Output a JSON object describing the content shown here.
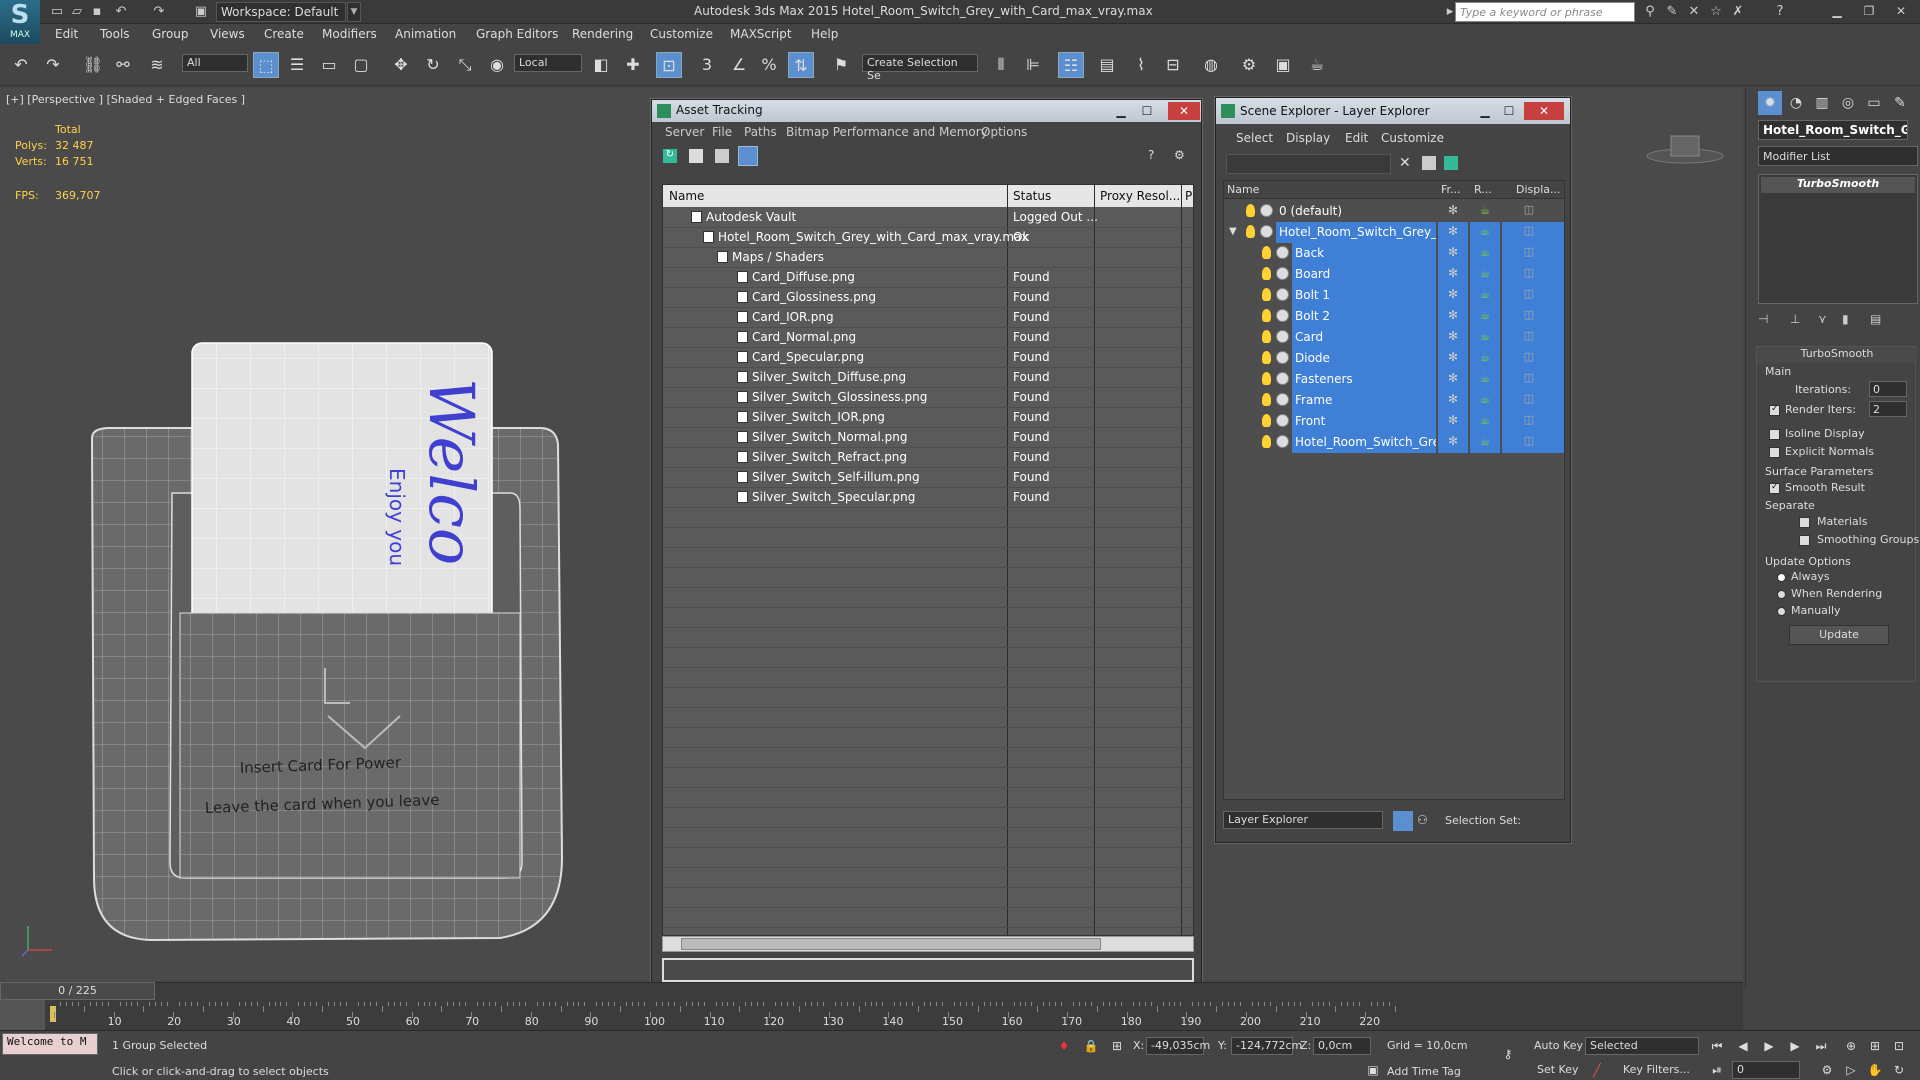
{
  "titlebar": {
    "logo_text": "MAX",
    "workspace": "Workspace: Default",
    "title": "Autodesk 3ds Max 2015    Hotel_Room_Switch_Grey_with_Card_max_vray.max",
    "search_placeholder": "Type a keyword or phrase"
  },
  "menu": [
    "Edit",
    "Tools",
    "Group",
    "Views",
    "Create",
    "Modifiers",
    "Animation",
    "Graph Editors",
    "Rendering",
    "Customize",
    "MAXScript",
    "Help"
  ],
  "toolbar": {
    "selection_filter": "All",
    "ref_coord": "Local",
    "named_selection": "Create Selection Se"
  },
  "viewport": {
    "label": "[+] [Perspective ] [Shaded + Edged Faces ]",
    "stats": {
      "total_label": "Total",
      "polys_label": "Polys:",
      "polys_value": "32 487",
      "verts_label": "Verts:",
      "verts_value": "16 751",
      "fps_label": "FPS:",
      "fps_value": "369,707"
    },
    "card_text_big": "Welco",
    "card_text_small": "Enjoy you",
    "plate_line1": "Insert Card For Power",
    "plate_line2": "Leave the card when you leave"
  },
  "asset_tracking": {
    "title": "Asset Tracking",
    "menu": [
      "Server",
      "File",
      "Paths",
      "Bitmap Performance and Memory",
      "Options"
    ],
    "columns": [
      "Name",
      "Status",
      "Proxy Resol...",
      "P"
    ],
    "rows": [
      {
        "name": "Autodesk Vault",
        "status": "Logged Out ..."
      },
      {
        "name": "Hotel_Room_Switch_Grey_with_Card_max_vray.max",
        "status": "Ok"
      },
      {
        "name": "Maps / Shaders",
        "status": ""
      },
      {
        "name": "Card_Diffuse.png",
        "status": "Found"
      },
      {
        "name": "Card_Glossiness.png",
        "status": "Found"
      },
      {
        "name": "Card_IOR.png",
        "status": "Found"
      },
      {
        "name": "Card_Normal.png",
        "status": "Found"
      },
      {
        "name": "Card_Specular.png",
        "status": "Found"
      },
      {
        "name": "Silver_Switch_Diffuse.png",
        "status": "Found"
      },
      {
        "name": "Silver_Switch_Glossiness.png",
        "status": "Found"
      },
      {
        "name": "Silver_Switch_IOR.png",
        "status": "Found"
      },
      {
        "name": "Silver_Switch_Normal.png",
        "status": "Found"
      },
      {
        "name": "Silver_Switch_Refract.png",
        "status": "Found"
      },
      {
        "name": "Silver_Switch_Self-illum.png",
        "status": "Found"
      },
      {
        "name": "Silver_Switch_Specular.png",
        "status": "Found"
      }
    ]
  },
  "scene_explorer": {
    "title": "Scene Explorer - Layer Explorer",
    "menu": [
      "Select",
      "Display",
      "Edit",
      "Customize"
    ],
    "columns": [
      "Name",
      "Fr...",
      "R...",
      "Displa..."
    ],
    "rows": [
      {
        "name": "0 (default)"
      },
      {
        "name": "Hotel_Room_Switch_Grey_with..."
      },
      {
        "name": "Back"
      },
      {
        "name": "Board"
      },
      {
        "name": "Bolt 1"
      },
      {
        "name": "Bolt 2"
      },
      {
        "name": "Card"
      },
      {
        "name": "Diode"
      },
      {
        "name": "Fasteners"
      },
      {
        "name": "Frame"
      },
      {
        "name": "Front"
      },
      {
        "name": "Hotel_Room_Switch_Grey_..."
      }
    ],
    "footer_explorer": "Layer Explorer",
    "footer_selset": "Selection Set:"
  },
  "command_panel": {
    "object_name": "Hotel_Room_Switch_Gre",
    "modifier_list": "Modifier List",
    "stack_item": "TurboSmooth",
    "rollout_title": "TurboSmooth",
    "main_label": "Main",
    "iterations_label": "Iterations:",
    "iterations_value": "0",
    "render_iters_label": "Render Iters:",
    "render_iters_value": "2",
    "isoline": "Isoline Display",
    "explicit_normals": "Explicit Normals",
    "surface_params": "Surface Parameters",
    "smooth_result": "Smooth Result",
    "separate": "Separate",
    "materials": "Materials",
    "smoothing_groups": "Smoothing Groups",
    "update_options": "Update Options",
    "always": "Always",
    "when_rendering": "When Rendering",
    "manually": "Manually",
    "update_btn": "Update"
  },
  "timeline": {
    "slider": "0 / 225",
    "ticks": [
      "10",
      "20",
      "30",
      "40",
      "50",
      "60",
      "70",
      "80",
      "90",
      "100",
      "110",
      "120",
      "130",
      "140",
      "150",
      "160",
      "170",
      "180",
      "190",
      "200",
      "210",
      "220"
    ]
  },
  "statusbar": {
    "welcome": "Welcome to M",
    "selected": "1 Group Selected",
    "prompt": "Click or click-and-drag to select objects",
    "x_label": "X:",
    "x_value": "-49,035cm",
    "y_label": "Y:",
    "y_value": "-124,772cm",
    "z_label": "Z:",
    "z_value": "0,0cm",
    "grid": "Grid = 10,0cm",
    "add_time_tag": "Add Time Tag",
    "auto_key": "Auto Key",
    "set_key": "Set Key",
    "selected_dropdown": "Selected",
    "key_filters": "Key Filters...",
    "frame": "0"
  }
}
